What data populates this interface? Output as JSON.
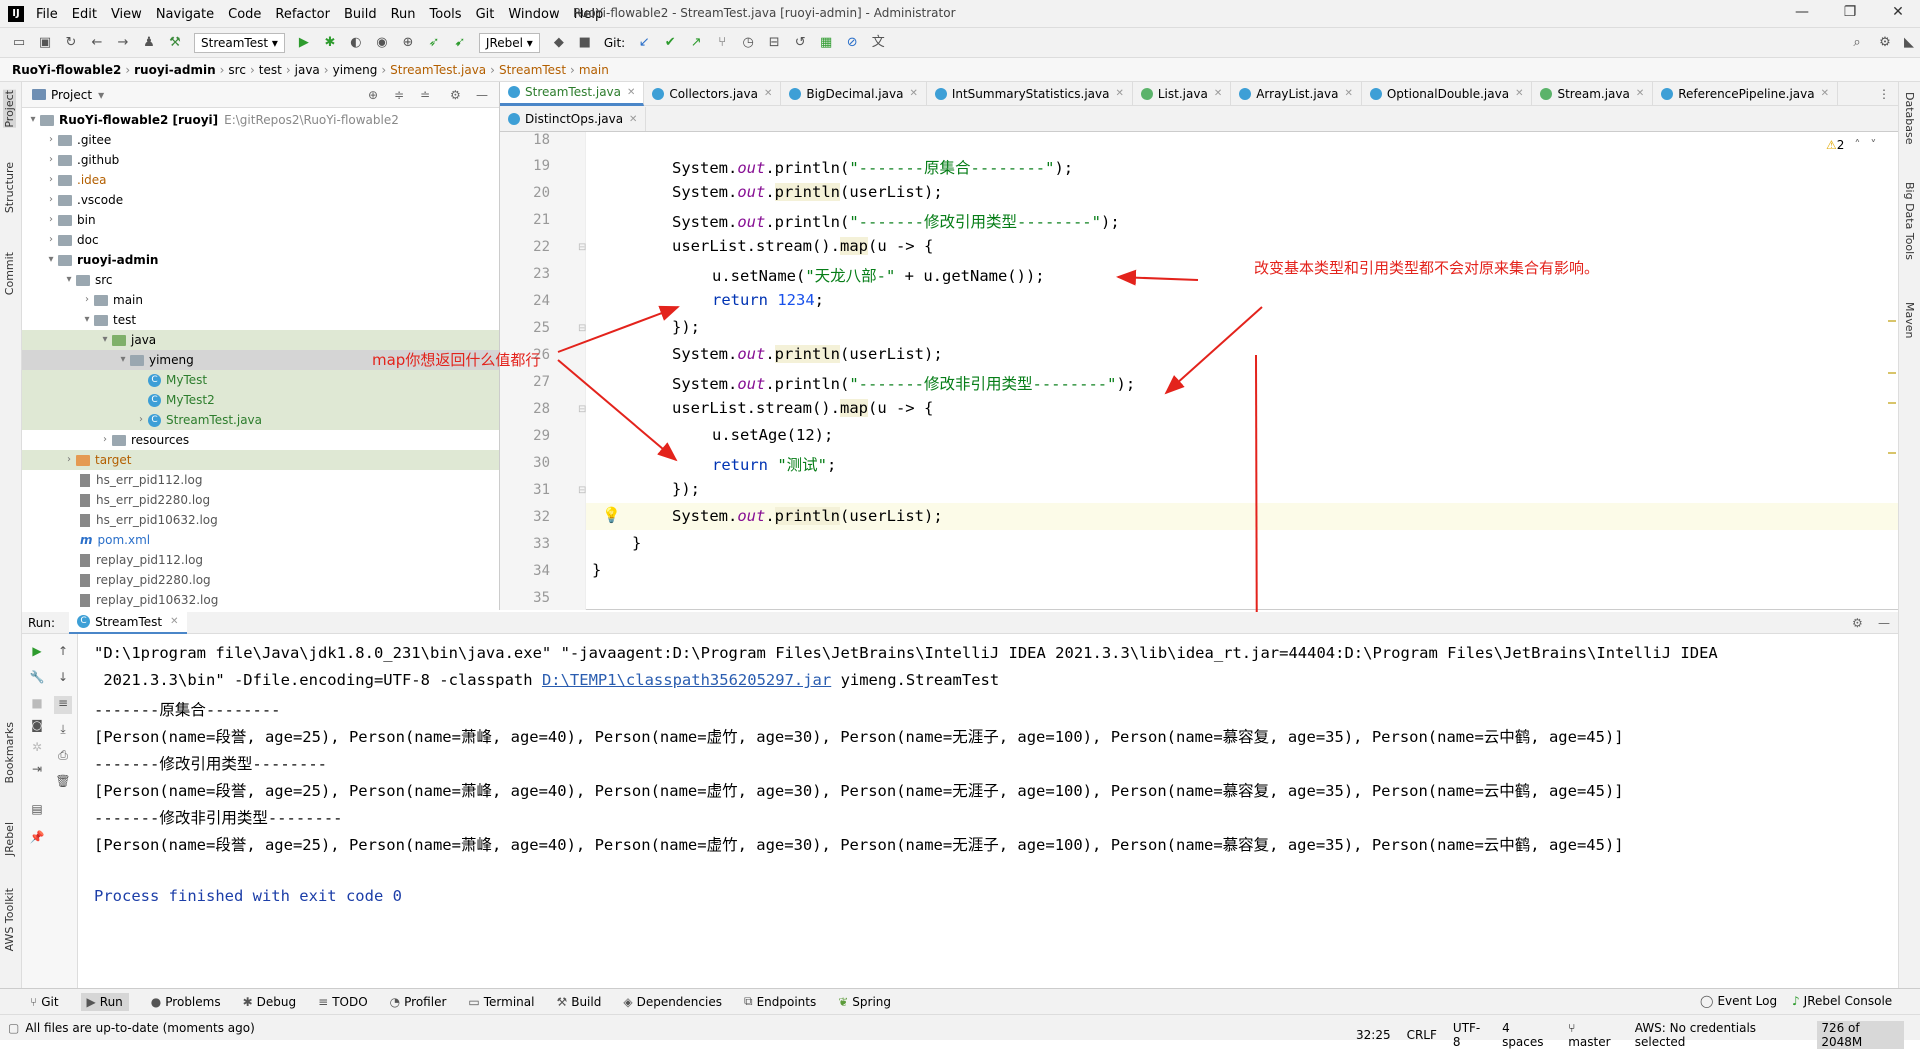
{
  "window": {
    "title": "RuoYi-flowable2 - StreamTest.java [ruoyi-admin] - Administrator",
    "logo": "IJ"
  },
  "menu": [
    "File",
    "Edit",
    "View",
    "Navigate",
    "Code",
    "Refactor",
    "Build",
    "Run",
    "Tools",
    "Git",
    "Window",
    "Help"
  ],
  "toolbar": {
    "run_config": "StreamTest",
    "jrebel": "JRebel",
    "git_label": "Git:"
  },
  "breadcrumb": [
    "RuoYi-flowable2",
    "ruoyi-admin",
    "src",
    "test",
    "java",
    "yimeng",
    "StreamTest.java",
    "StreamTest",
    "main"
  ],
  "left_strip": [
    "Project",
    "Structure",
    "Commit",
    "Bookmarks",
    "JRebel",
    "AWS Toolkit"
  ],
  "right_strip": [
    "Database",
    "Big Data Tools",
    "Maven"
  ],
  "project": {
    "header": "Project",
    "root": "RuoYi-flowable2 [ruoyi]",
    "root_path": "E:\\gitRepos2\\RuoYi-flowable2",
    "items": [
      ".gitee",
      ".github",
      ".idea",
      ".vscode",
      "bin",
      "doc",
      "ruoyi-admin",
      "src",
      "main",
      "test",
      "java",
      "yimeng",
      "MyTest",
      "MyTest2",
      "StreamTest.java",
      "resources",
      "target",
      "hs_err_pid112.log",
      "hs_err_pid2280.log",
      "hs_err_pid10632.log",
      "pom.xml",
      "replay_pid112.log",
      "replay_pid2280.log",
      "replay_pid10632.log"
    ]
  },
  "tabs": {
    "row1": [
      "StreamTest.java",
      "Collectors.java",
      "BigDecimal.java",
      "IntSummaryStatistics.java",
      "List.java",
      "ArrayList.java",
      "OptionalDouble.java",
      "Stream.java",
      "ReferencePipeline.java"
    ],
    "row2": [
      "DistinctOps.java"
    ]
  },
  "editor": {
    "warnings": "2",
    "line_numbers": [
      "18",
      "19",
      "20",
      "21",
      "22",
      "23",
      "24",
      "25",
      "26",
      "27",
      "28",
      "29",
      "30",
      "31",
      "32",
      "33",
      "34",
      "35"
    ],
    "code": {
      "l19a": "System.",
      "l19b": "out",
      "l19c": ".println(",
      "l19d": "\"-------原集合--------\"",
      "l19e": ");",
      "l20a": "System.",
      "l20b": "out",
      "l20c": ".",
      "l20d": "println",
      "l20e": "(userList);",
      "l21a": "System.",
      "l21b": "out",
      "l21c": ".println(",
      "l21d": "\"-------修改引用类型--------\"",
      "l21e": ");",
      "l22a": "userList.stream().",
      "l22b": "map",
      "l22c": "(u -> {",
      "l23a": "u.setName(",
      "l23b": "\"天龙八部-\"",
      "l23c": " + u.getName());",
      "l24a": "return ",
      "l24b": "1234",
      "l24c": ";",
      "l25": "});",
      "l26a": "System.",
      "l26b": "out",
      "l26c": ".",
      "l26d": "println",
      "l26e": "(userList);",
      "l27a": "System.",
      "l27b": "out",
      "l27c": ".println(",
      "l27d": "\"-------修改非引用类型--------\"",
      "l27e": ");",
      "l28a": "userList.stream().",
      "l28b": "map",
      "l28c": "(u -> {",
      "l29": "u.setAge(12);",
      "l30a": "return ",
      "l30b": "\"测试\"",
      "l30c": ";",
      "l31": "});",
      "l32a": "System.",
      "l32b": "out",
      "l32c": ".",
      "l32d": "println",
      "l32e": "(userList);",
      "l33": "}",
      "l34": "}"
    }
  },
  "annotations": {
    "right": "改变基本类型和引用类型都不会对原来集合有影响。",
    "left": "map你想返回什么值都行"
  },
  "run": {
    "label": "Run:",
    "tab": "StreamTest",
    "cmd1": "\"D:\\1program file\\Java\\jdk1.8.0_231\\bin\\java.exe\" \"-javaagent:D:\\Program Files\\JetBrains\\IntelliJ IDEA 2021.3.3\\lib\\idea_rt.jar=44404:D:\\Program Files\\JetBrains\\IntelliJ IDEA",
    "cmd2a": " 2021.3.3\\bin\" -Dfile.encoding=UTF-8 -classpath ",
    "cmd2link": "D:\\TEMP1\\classpath356205297.jar",
    "cmd2b": " yimeng.StreamTest",
    "out1": "-------原集合--------",
    "out2": "[Person(name=段誉, age=25), Person(name=萧峰, age=40), Person(name=虚竹, age=30), Person(name=无涯子, age=100), Person(name=慕容复, age=35), Person(name=云中鹤, age=45)]",
    "out3": "-------修改引用类型--------",
    "out4": "[Person(name=段誉, age=25), Person(name=萧峰, age=40), Person(name=虚竹, age=30), Person(name=无涯子, age=100), Person(name=慕容复, age=35), Person(name=云中鹤, age=45)]",
    "out5": "-------修改非引用类型--------",
    "out6": "[Person(name=段誉, age=25), Person(name=萧峰, age=40), Person(name=虚竹, age=30), Person(name=无涯子, age=100), Person(name=慕容复, age=35), Person(name=云中鹤, age=45)]",
    "finish": "Process finished with exit code 0"
  },
  "bottom_tabs": [
    "Git",
    "Run",
    "Problems",
    "Debug",
    "TODO",
    "Profiler",
    "Terminal",
    "Build",
    "Dependencies",
    "Endpoints",
    "Spring"
  ],
  "bottom_right": [
    "Event Log",
    "JRebel Console"
  ],
  "status": {
    "message": "All files are up-to-date (moments ago)",
    "position": "32:25",
    "eol": "CRLF",
    "encoding": "UTF-8",
    "indent": "4 spaces",
    "branch": "master",
    "aws": "AWS: No credentials selected",
    "memory": "726 of 2048M"
  },
  "colors": {
    "accent": "#4a86c8",
    "annotation": "#e3231c",
    "keyword": "#0033b3",
    "string": "#067d17"
  }
}
